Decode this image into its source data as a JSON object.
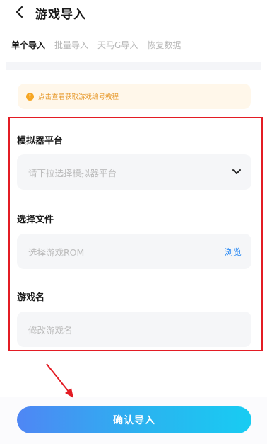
{
  "header": {
    "title": "游戏导入",
    "back_icon": "chevron-left-icon"
  },
  "tabs": [
    {
      "label": "单个导入",
      "active": true
    },
    {
      "label": "批量导入",
      "active": false
    },
    {
      "label": "天马G导入",
      "active": false
    },
    {
      "label": "恢复数据",
      "active": false
    }
  ],
  "notice": {
    "icon": "info-icon",
    "text": "点击查看获取游戏编号教程",
    "color": "#e79a2d"
  },
  "form": {
    "platform": {
      "label": "模拟器平台",
      "placeholder": "请下拉选择模拟器平台"
    },
    "file": {
      "label": "选择文件",
      "placeholder": "选择游戏ROM",
      "browse_label": "浏览"
    },
    "name": {
      "label": "游戏名",
      "placeholder": "修改游戏名"
    }
  },
  "confirm": {
    "label": "确认导入"
  },
  "colors": {
    "accent": "#2f8cf3",
    "highlight_border": "#e31c24",
    "annotation_arrow": "#e31c24"
  }
}
